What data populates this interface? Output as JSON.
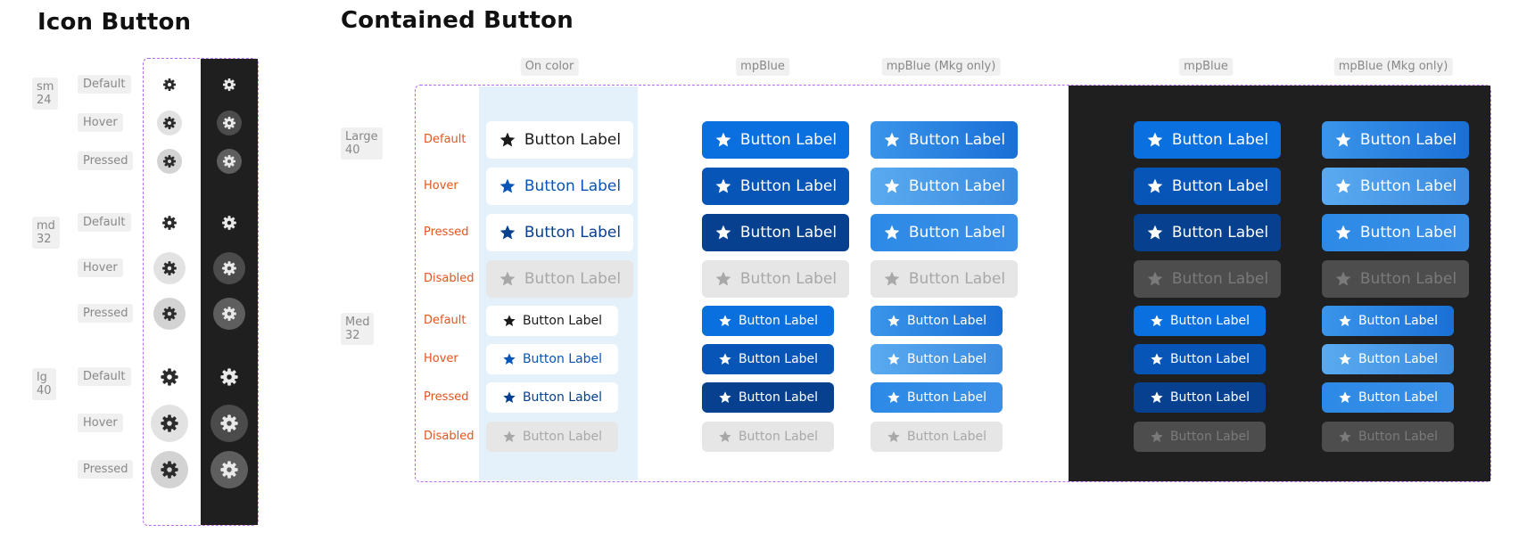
{
  "headings": {
    "icon_button": "Icon Button",
    "contained_button": "Contained Button"
  },
  "icon_button": {
    "sizes": [
      {
        "name": "sm",
        "px": "24"
      },
      {
        "name": "md",
        "px": "32"
      },
      {
        "name": "lg",
        "px": "40"
      }
    ],
    "states": [
      "Default",
      "Hover",
      "Pressed"
    ],
    "icon": "gear-icon"
  },
  "contained_button": {
    "column_headers": [
      "On color",
      "mpBlue",
      "mpBlue (Mkg only)",
      "mpBlue",
      "mpBlue (Mkg only)"
    ],
    "sizes": [
      {
        "name": "Large",
        "px": "40"
      },
      {
        "name": "Med",
        "px": "32"
      }
    ],
    "states": [
      "Default",
      "Hover",
      "Pressed",
      "Disabled"
    ],
    "button_label": "Button Label",
    "icon": "star-icon"
  },
  "colors": {
    "frame_dash": "#b86cf2",
    "state_label": "#e4541d",
    "on_color_bg": "#e4f1fb",
    "dark_bg": "#1f1f1f",
    "mpblue_default": "#0a6fdf",
    "mpblue_hover": "#0755b7",
    "mpblue_pressed": "#07408e",
    "mkg_default": "#2f8ee6",
    "mkg_hover": "#4aa0ec",
    "mkg_pressed": "#2e8ae4",
    "disabled_bg": "#e6e6e6",
    "disabled_text": "#a8a8a8"
  }
}
